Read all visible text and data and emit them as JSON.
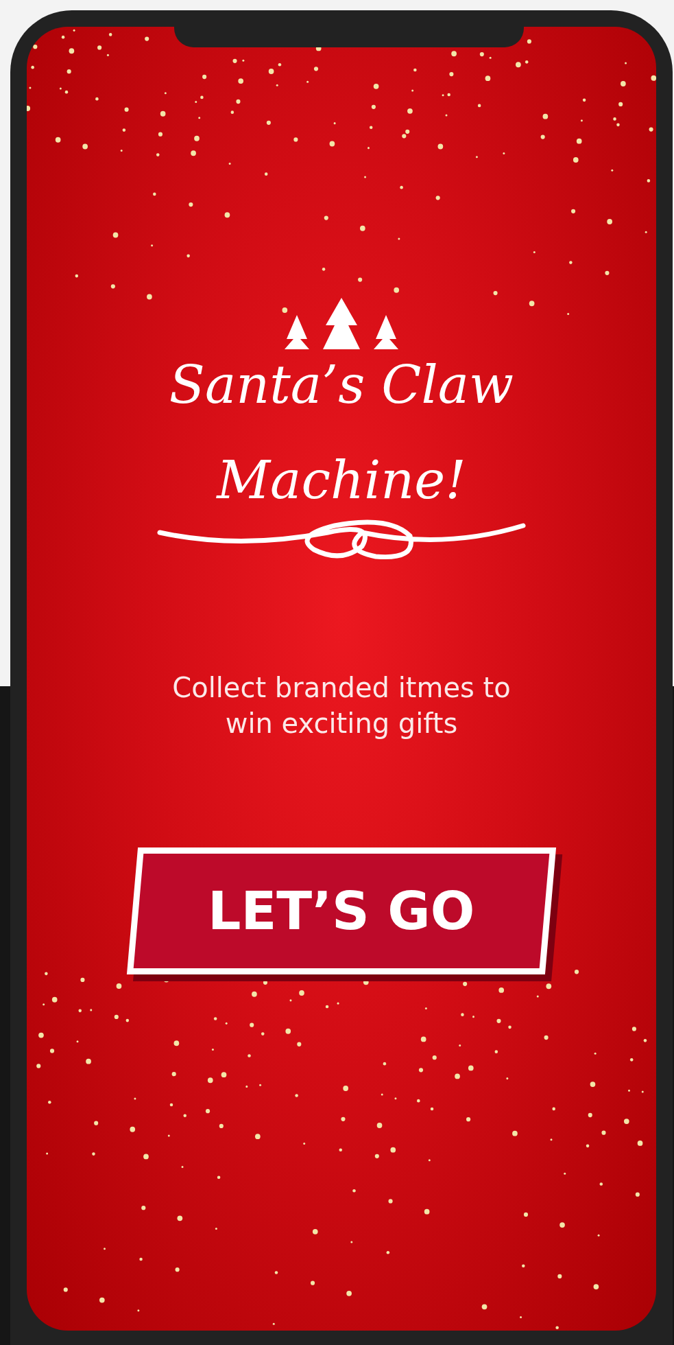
{
  "title_line_1": "Santa’s Claw",
  "title_line_2": "Machine!",
  "tagline": "Collect branded itmes to win exciting gifts",
  "button": "LET’S GO"
}
